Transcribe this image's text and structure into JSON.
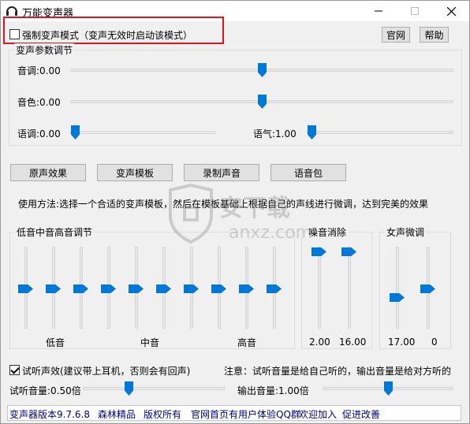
{
  "window": {
    "title": "万能变声器"
  },
  "titlebar": {
    "min_icon": "minimize-icon",
    "max_icon": "maximize-icon",
    "close_icon": "close-icon"
  },
  "force_mode": {
    "label": "强制变声模式（变声无效时启动该模式）",
    "checked": false
  },
  "top_buttons": {
    "official": "官网",
    "help": "帮助"
  },
  "params": {
    "group_label": "变声参数调节",
    "pitch": {
      "label": "音调:0.00",
      "value": 0.0
    },
    "timbre": {
      "label": "音色:0.00",
      "value": 0.0
    },
    "speed": {
      "label": "语调:0.00",
      "value": 0.0
    },
    "tone": {
      "label": "语气:1.00",
      "value": 1.0
    }
  },
  "actions": {
    "original": "原声效果",
    "template": "变声模板",
    "record": "录制声音",
    "voice_pack": "语音包"
  },
  "usage": "使用方法:选择一个合适的变声模板，然后在模板基础上根据自己的声线进行微调，达到完美的效果",
  "eq": {
    "group_label": "低音中音高音调节",
    "bands": [
      0,
      0,
      0,
      0,
      0,
      0,
      0,
      0,
      0,
      0
    ],
    "low_label": "低音",
    "mid_label": "中音",
    "high_label": "高音"
  },
  "noise": {
    "group_label": "噪音消除",
    "values": [
      "2.00",
      "16.00"
    ]
  },
  "female": {
    "group_label": "女声微调",
    "values": [
      "17.00",
      "0"
    ]
  },
  "monitor": {
    "label": "试听声效(建议带上耳机，否则会有回声)",
    "checked": true
  },
  "note": "注意：试听音量是给自己听的，输出音量是给对方听的",
  "volumes": {
    "monitor_label": "试听音量:0.50倍",
    "monitor_value": 0.5,
    "output_label": "输出音量:1.00倍",
    "output_value": 1.0
  },
  "status": {
    "version": "变声器版本9.7.6.8",
    "brand": "森林精品",
    "rights": "版权所有",
    "qq": "官网首页有用户体验QQ群",
    "join": "欢迎加入",
    "improve": "促进改善"
  },
  "watermark": {
    "text": "安下载",
    "domain": "anxz.com"
  }
}
